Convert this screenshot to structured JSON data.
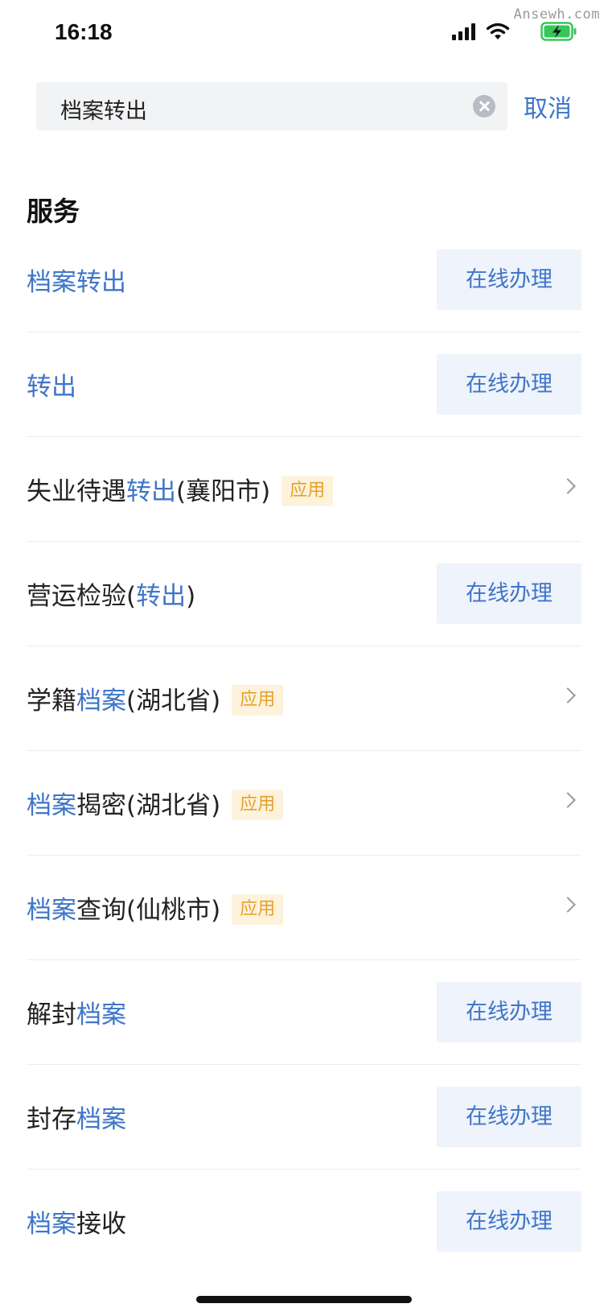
{
  "watermark": "Ansewh.com",
  "status_bar": {
    "time": "16:18",
    "icons": [
      "signal-icon",
      "wifi-icon",
      "battery-charging-icon"
    ],
    "battery_color": "#34c759"
  },
  "search": {
    "query": "档案转出",
    "cancel_label": "取消"
  },
  "section_title": "服务",
  "highlight_color": "#3f75c8",
  "tag_label": "应用",
  "action_label": "在线办理",
  "services": [
    {
      "segments": [
        {
          "t": "档案转出",
          "hl": true
        }
      ],
      "action": "button"
    },
    {
      "segments": [
        {
          "t": "转出",
          "hl": true
        }
      ],
      "action": "button"
    },
    {
      "segments": [
        {
          "t": "失业待遇",
          "hl": false
        },
        {
          "t": "转出",
          "hl": true
        },
        {
          "t": "(襄阳市)",
          "hl": false
        }
      ],
      "tag": true,
      "action": "chevron"
    },
    {
      "segments": [
        {
          "t": "营运检验(",
          "hl": false
        },
        {
          "t": "转出",
          "hl": true
        },
        {
          "t": ")",
          "hl": false
        }
      ],
      "action": "button"
    },
    {
      "segments": [
        {
          "t": "学籍",
          "hl": false
        },
        {
          "t": "档案",
          "hl": true
        },
        {
          "t": "(湖北省)",
          "hl": false
        }
      ],
      "tag": true,
      "action": "chevron"
    },
    {
      "segments": [
        {
          "t": "档案",
          "hl": true
        },
        {
          "t": "揭密(湖北省)",
          "hl": false
        }
      ],
      "tag": true,
      "action": "chevron"
    },
    {
      "segments": [
        {
          "t": "档案",
          "hl": true
        },
        {
          "t": "查询(仙桃市)",
          "hl": false
        }
      ],
      "tag": true,
      "action": "chevron"
    },
    {
      "segments": [
        {
          "t": "解封",
          "hl": false
        },
        {
          "t": "档案",
          "hl": true
        }
      ],
      "action": "button"
    },
    {
      "segments": [
        {
          "t": "封存",
          "hl": false
        },
        {
          "t": "档案",
          "hl": true
        }
      ],
      "action": "button"
    },
    {
      "segments": [
        {
          "t": "档案",
          "hl": true
        },
        {
          "t": "接收",
          "hl": false
        }
      ],
      "action": "button"
    }
  ]
}
